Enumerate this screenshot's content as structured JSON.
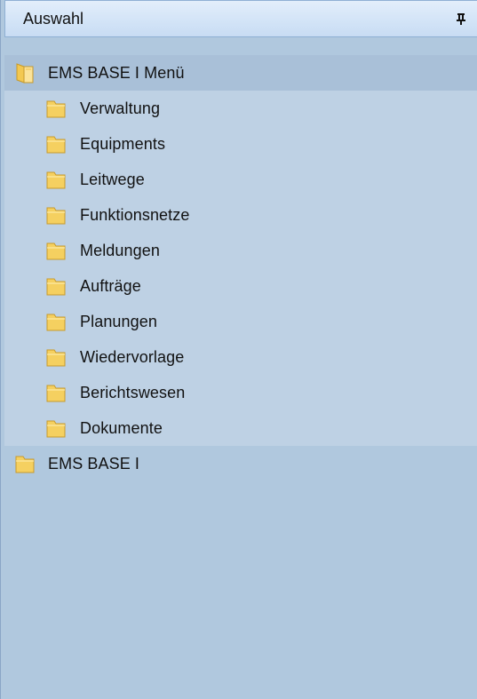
{
  "header": {
    "title": "Auswahl"
  },
  "tree": {
    "root_open": {
      "label": "EMS BASE I Menü",
      "children": [
        {
          "label": "Verwaltung"
        },
        {
          "label": "Equipments"
        },
        {
          "label": "Leitwege"
        },
        {
          "label": "Funktionsnetze"
        },
        {
          "label": "Meldungen"
        },
        {
          "label": "Aufträge"
        },
        {
          "label": "Planungen"
        },
        {
          "label": "Wiedervorlage"
        },
        {
          "label": "Berichtswesen"
        },
        {
          "label": "Dokumente"
        }
      ]
    },
    "root_closed": {
      "label": "EMS BASE I"
    }
  },
  "icons": {
    "pin": "pin-icon",
    "folder_open": "folder-open-icon",
    "folder": "folder-icon"
  },
  "colors": {
    "panel_background": "#b0c8de",
    "selected_row": "#a9c0d8",
    "children_background": "#bed1e4",
    "folder_yellow": "#f5d060"
  }
}
